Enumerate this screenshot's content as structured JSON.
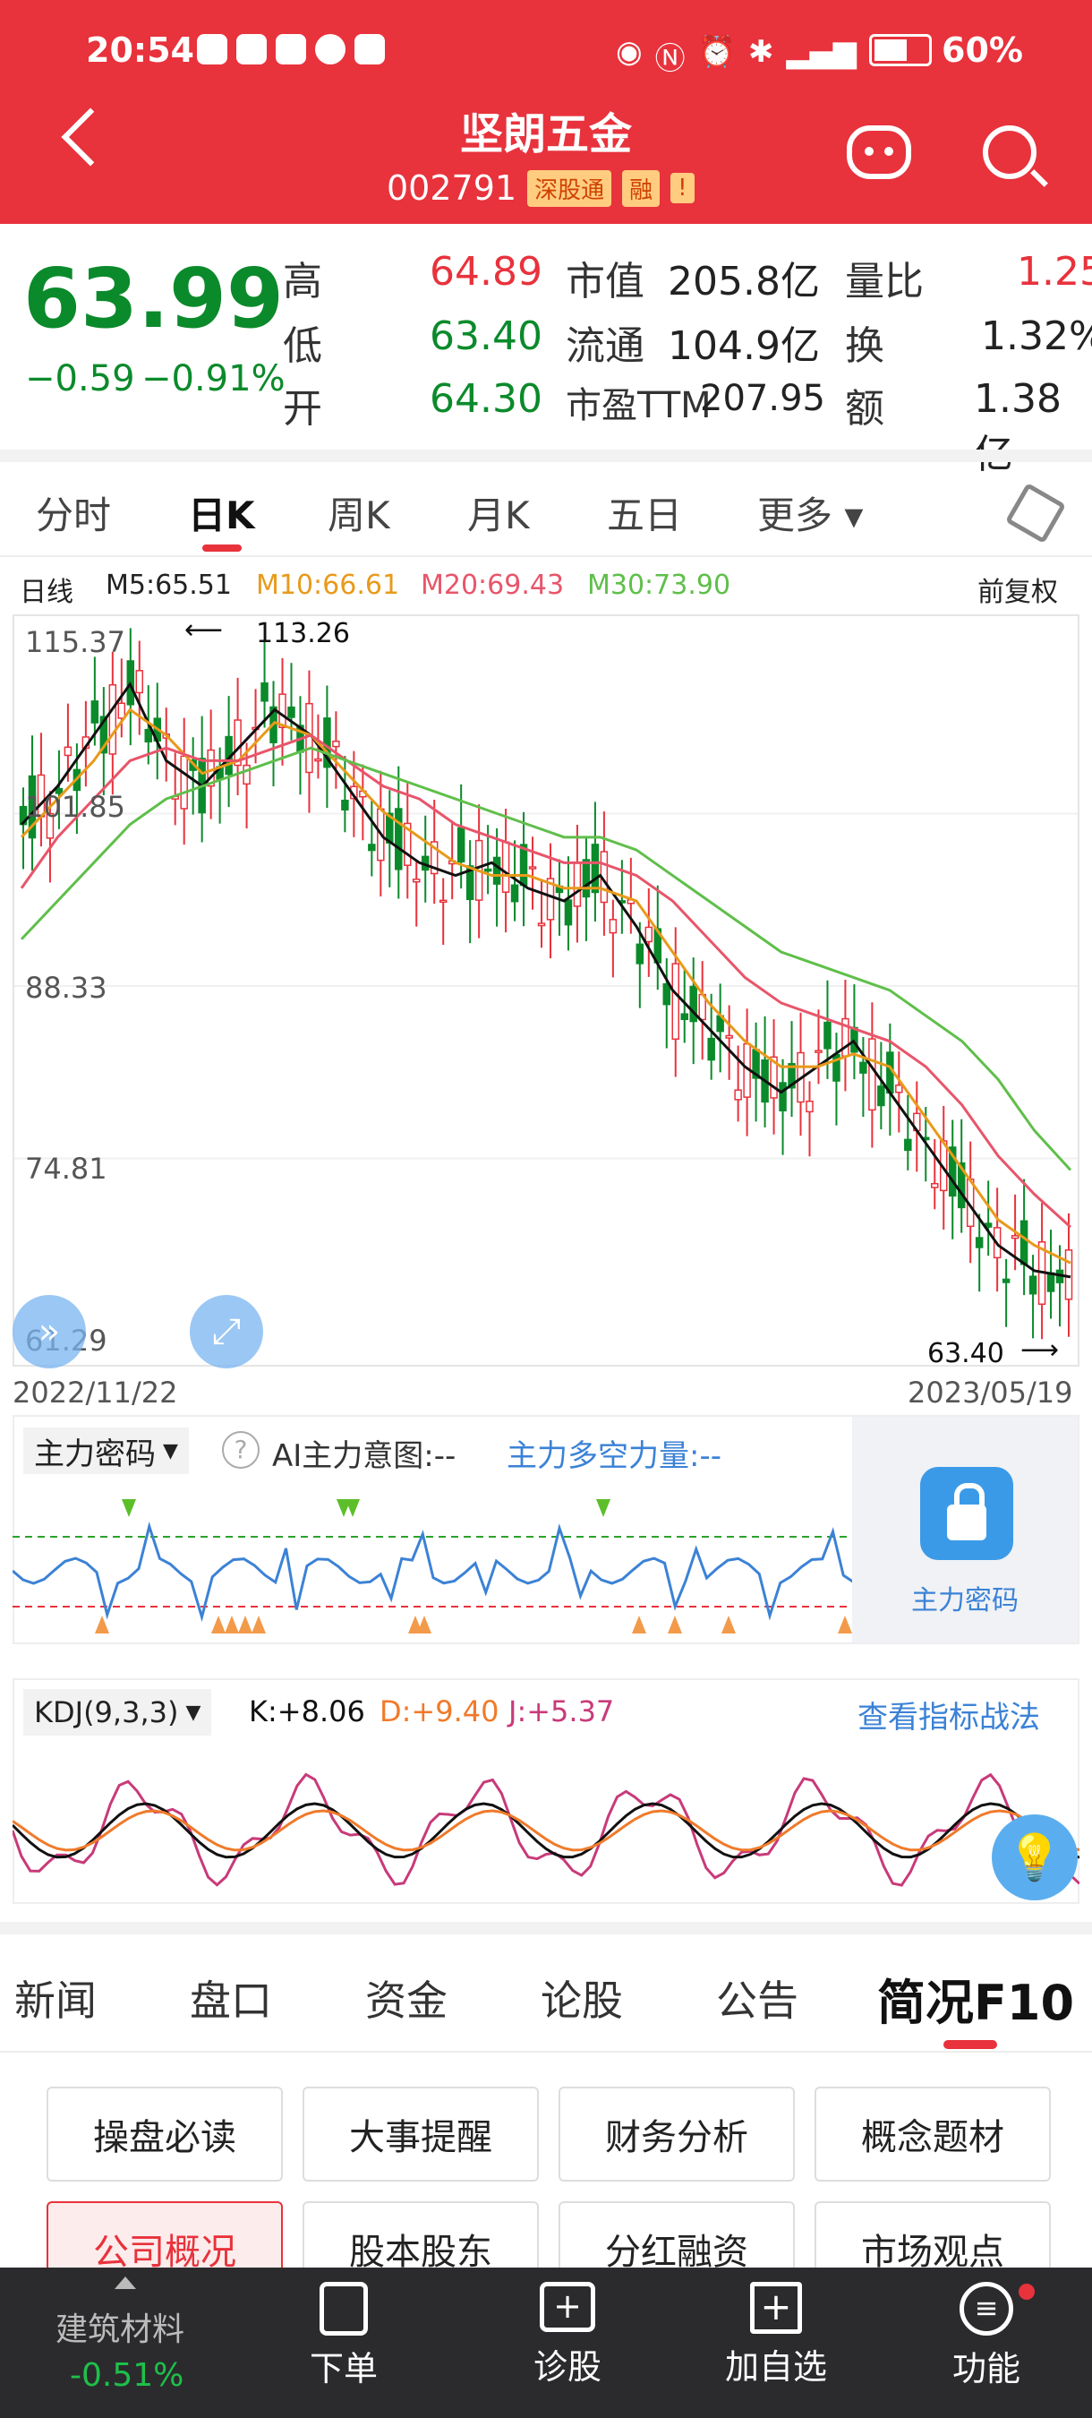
{
  "status_bar": {
    "time": "20:54",
    "battery": "60%"
  },
  "header": {
    "title": "坚朗五金",
    "code": "002791",
    "tag1": "深股通",
    "tag2": "融",
    "tag3": "!"
  },
  "quote": {
    "price": "63.99",
    "change": "−0.59",
    "change_pct": "−0.91%",
    "high_label": "高",
    "high": "64.89",
    "low_label": "低",
    "low": "63.40",
    "open_label": "开",
    "open": "64.30",
    "mktcap_label": "市值",
    "mktcap": "205.8亿",
    "float_label": "流通",
    "float": "104.9亿",
    "pe_label": "市盈TTM",
    "pe": "207.95",
    "volratio_label": "量比",
    "volratio": "1.25",
    "turnover_label": "换",
    "turnover": "1.32%",
    "amount_label": "额",
    "amount": "1.38亿"
  },
  "chart_tabs": [
    "分时",
    "日K",
    "周K",
    "月K",
    "五日",
    "更多 ▾"
  ],
  "ma_line": {
    "period": "日线",
    "m5": "M5:65.51",
    "m10": "M10:66.61",
    "m20": "M20:69.43",
    "m30": "M30:73.90",
    "adjust": "前复权"
  },
  "price_axis": {
    "top": "115.37",
    "mid1": "101.85",
    "mid2": "88.33",
    "mid3": "74.81",
    "bottom": "61.29"
  },
  "annotations": {
    "high_mark": "113.26",
    "low_mark": "63.40"
  },
  "dates": {
    "start": "2022/11/22",
    "end": "2023/05/19"
  },
  "indicator1": {
    "name": "主力密码",
    "ai_label": "AI主力意图:--",
    "power_label": "主力多空力量:--",
    "lock_label": "主力密码"
  },
  "indicator2": {
    "name": "KDJ(9,3,3)",
    "k": "K:+8.06",
    "d": "D:+9.40",
    "j": "J:+5.37",
    "link": "查看指标战法"
  },
  "info_tabs": [
    "新闻",
    "盘口",
    "资金",
    "论股",
    "公告",
    "简况F10"
  ],
  "info_buttons": [
    "操盘必读",
    "大事提醒",
    "财务分析",
    "概念题材",
    "公司概况",
    "股本股东",
    "分红融资",
    "市场观点"
  ],
  "bottom_bar": {
    "sector": "建筑材料",
    "sector_change": "-0.51%",
    "order": "下单",
    "diagnose": "诊股",
    "add": "加自选",
    "func": "功能"
  },
  "colors": {
    "up": "#e8323c",
    "down": "#0b8a2b",
    "m5": "#111111",
    "m10": "#e89a1a",
    "m20": "#e8556a",
    "m30": "#5fbf4a"
  },
  "chart_data": {
    "type": "line",
    "title": "",
    "x": [
      "2022/11/22",
      "2023/05/19"
    ],
    "ylim": [
      61.29,
      115.37
    ],
    "series": [
      {
        "name": "M5",
        "values": [
          101,
          104,
          108,
          112,
          106,
          104,
          107,
          110,
          108,
          104,
          100,
          98,
          97,
          98,
          96,
          95,
          97,
          93,
          88,
          85,
          82,
          80,
          82,
          84,
          80,
          76,
          72,
          68,
          66,
          65.51
        ]
      },
      {
        "name": "M10",
        "values": [
          100,
          103,
          106,
          110,
          108,
          105,
          106,
          109,
          108,
          105,
          102,
          100,
          98,
          97,
          97,
          96,
          96,
          95,
          91,
          87,
          84,
          82,
          82,
          83,
          82,
          78,
          74,
          70,
          68,
          66.61
        ]
      },
      {
        "name": "M20",
        "values": [
          96,
          100,
          103,
          106,
          107,
          106,
          106,
          107,
          108,
          106,
          104,
          103,
          101,
          100,
          99,
          98,
          98,
          97,
          95,
          92,
          89,
          87,
          86,
          85,
          84,
          82,
          79,
          75,
          72,
          69.43
        ]
      },
      {
        "name": "M30",
        "values": [
          92,
          95,
          98,
          101,
          103,
          104,
          105,
          106,
          107,
          106,
          105,
          104,
          103,
          102,
          101,
          100,
          100,
          99,
          97,
          95,
          93,
          91,
          90,
          89,
          88,
          86,
          84,
          81,
          77,
          73.9
        ]
      }
    ]
  }
}
